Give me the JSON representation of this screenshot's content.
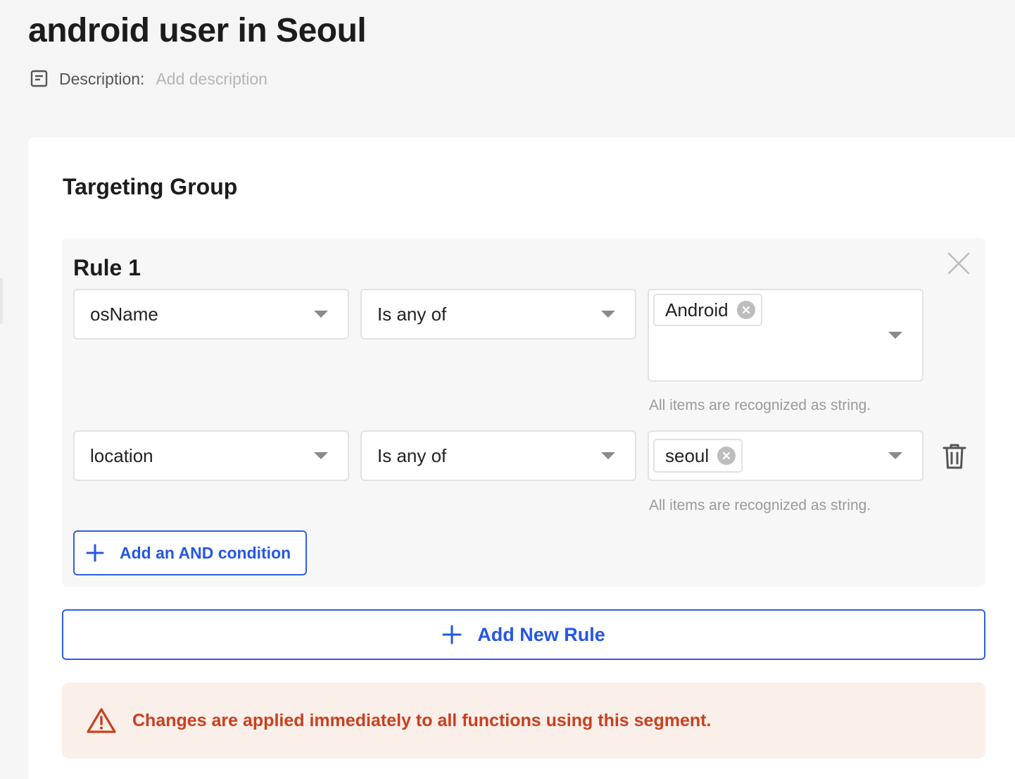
{
  "header": {
    "title": "android user in Seoul",
    "description_label": "Description:",
    "description_placeholder": "Add description"
  },
  "targeting": {
    "title": "Targeting Group",
    "rules": [
      {
        "title": "Rule 1",
        "conditions": [
          {
            "attribute": "osName",
            "operator": "Is any of",
            "values": [
              "Android"
            ],
            "hint": "All items are recognized as string."
          },
          {
            "attribute": "location",
            "operator": "Is any of",
            "values": [
              "seoul"
            ],
            "hint": "All items are recognized as string."
          }
        ],
        "add_condition_label": "Add an AND condition"
      }
    ],
    "add_rule_label": "Add New Rule"
  },
  "alert": {
    "message": "Changes are applied immediately to all functions using this segment."
  },
  "icons": {
    "description": "note-icon",
    "close": "close-icon",
    "delete": "trash-icon",
    "add": "plus-icon",
    "warning": "warning-triangle-icon",
    "tag_remove": "remove-circle-icon",
    "dropdown": "caret-down-icon"
  },
  "colors": {
    "accent": "#2457e6",
    "warning_text": "#c9401f",
    "warning_bg": "#fbefea"
  }
}
